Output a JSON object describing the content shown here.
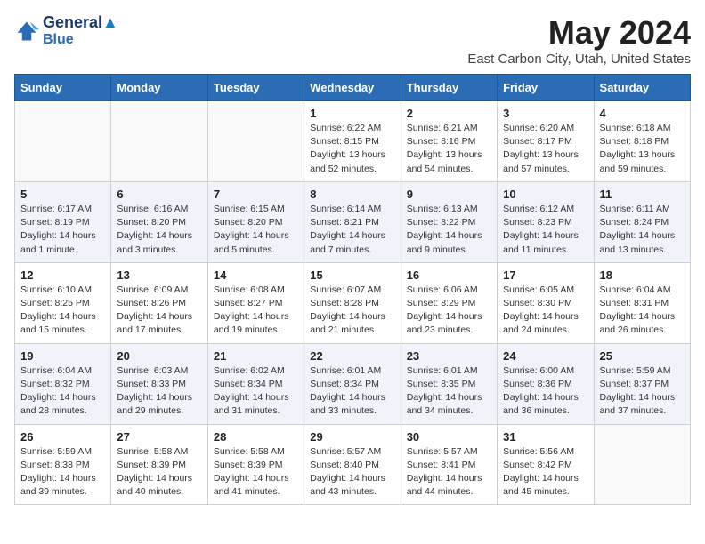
{
  "header": {
    "logo_line1": "General",
    "logo_line2": "Blue",
    "month_title": "May 2024",
    "location": "East Carbon City, Utah, United States"
  },
  "days_of_week": [
    "Sunday",
    "Monday",
    "Tuesday",
    "Wednesday",
    "Thursday",
    "Friday",
    "Saturday"
  ],
  "weeks": [
    [
      {
        "day": "",
        "info": ""
      },
      {
        "day": "",
        "info": ""
      },
      {
        "day": "",
        "info": ""
      },
      {
        "day": "1",
        "info": "Sunrise: 6:22 AM\nSunset: 8:15 PM\nDaylight: 13 hours\nand 52 minutes."
      },
      {
        "day": "2",
        "info": "Sunrise: 6:21 AM\nSunset: 8:16 PM\nDaylight: 13 hours\nand 54 minutes."
      },
      {
        "day": "3",
        "info": "Sunrise: 6:20 AM\nSunset: 8:17 PM\nDaylight: 13 hours\nand 57 minutes."
      },
      {
        "day": "4",
        "info": "Sunrise: 6:18 AM\nSunset: 8:18 PM\nDaylight: 13 hours\nand 59 minutes."
      }
    ],
    [
      {
        "day": "5",
        "info": "Sunrise: 6:17 AM\nSunset: 8:19 PM\nDaylight: 14 hours\nand 1 minute."
      },
      {
        "day": "6",
        "info": "Sunrise: 6:16 AM\nSunset: 8:20 PM\nDaylight: 14 hours\nand 3 minutes."
      },
      {
        "day": "7",
        "info": "Sunrise: 6:15 AM\nSunset: 8:20 PM\nDaylight: 14 hours\nand 5 minutes."
      },
      {
        "day": "8",
        "info": "Sunrise: 6:14 AM\nSunset: 8:21 PM\nDaylight: 14 hours\nand 7 minutes."
      },
      {
        "day": "9",
        "info": "Sunrise: 6:13 AM\nSunset: 8:22 PM\nDaylight: 14 hours\nand 9 minutes."
      },
      {
        "day": "10",
        "info": "Sunrise: 6:12 AM\nSunset: 8:23 PM\nDaylight: 14 hours\nand 11 minutes."
      },
      {
        "day": "11",
        "info": "Sunrise: 6:11 AM\nSunset: 8:24 PM\nDaylight: 14 hours\nand 13 minutes."
      }
    ],
    [
      {
        "day": "12",
        "info": "Sunrise: 6:10 AM\nSunset: 8:25 PM\nDaylight: 14 hours\nand 15 minutes."
      },
      {
        "day": "13",
        "info": "Sunrise: 6:09 AM\nSunset: 8:26 PM\nDaylight: 14 hours\nand 17 minutes."
      },
      {
        "day": "14",
        "info": "Sunrise: 6:08 AM\nSunset: 8:27 PM\nDaylight: 14 hours\nand 19 minutes."
      },
      {
        "day": "15",
        "info": "Sunrise: 6:07 AM\nSunset: 8:28 PM\nDaylight: 14 hours\nand 21 minutes."
      },
      {
        "day": "16",
        "info": "Sunrise: 6:06 AM\nSunset: 8:29 PM\nDaylight: 14 hours\nand 23 minutes."
      },
      {
        "day": "17",
        "info": "Sunrise: 6:05 AM\nSunset: 8:30 PM\nDaylight: 14 hours\nand 24 minutes."
      },
      {
        "day": "18",
        "info": "Sunrise: 6:04 AM\nSunset: 8:31 PM\nDaylight: 14 hours\nand 26 minutes."
      }
    ],
    [
      {
        "day": "19",
        "info": "Sunrise: 6:04 AM\nSunset: 8:32 PM\nDaylight: 14 hours\nand 28 minutes."
      },
      {
        "day": "20",
        "info": "Sunrise: 6:03 AM\nSunset: 8:33 PM\nDaylight: 14 hours\nand 29 minutes."
      },
      {
        "day": "21",
        "info": "Sunrise: 6:02 AM\nSunset: 8:34 PM\nDaylight: 14 hours\nand 31 minutes."
      },
      {
        "day": "22",
        "info": "Sunrise: 6:01 AM\nSunset: 8:34 PM\nDaylight: 14 hours\nand 33 minutes."
      },
      {
        "day": "23",
        "info": "Sunrise: 6:01 AM\nSunset: 8:35 PM\nDaylight: 14 hours\nand 34 minutes."
      },
      {
        "day": "24",
        "info": "Sunrise: 6:00 AM\nSunset: 8:36 PM\nDaylight: 14 hours\nand 36 minutes."
      },
      {
        "day": "25",
        "info": "Sunrise: 5:59 AM\nSunset: 8:37 PM\nDaylight: 14 hours\nand 37 minutes."
      }
    ],
    [
      {
        "day": "26",
        "info": "Sunrise: 5:59 AM\nSunset: 8:38 PM\nDaylight: 14 hours\nand 39 minutes."
      },
      {
        "day": "27",
        "info": "Sunrise: 5:58 AM\nSunset: 8:39 PM\nDaylight: 14 hours\nand 40 minutes."
      },
      {
        "day": "28",
        "info": "Sunrise: 5:58 AM\nSunset: 8:39 PM\nDaylight: 14 hours\nand 41 minutes."
      },
      {
        "day": "29",
        "info": "Sunrise: 5:57 AM\nSunset: 8:40 PM\nDaylight: 14 hours\nand 43 minutes."
      },
      {
        "day": "30",
        "info": "Sunrise: 5:57 AM\nSunset: 8:41 PM\nDaylight: 14 hours\nand 44 minutes."
      },
      {
        "day": "31",
        "info": "Sunrise: 5:56 AM\nSunset: 8:42 PM\nDaylight: 14 hours\nand 45 minutes."
      },
      {
        "day": "",
        "info": ""
      }
    ]
  ]
}
